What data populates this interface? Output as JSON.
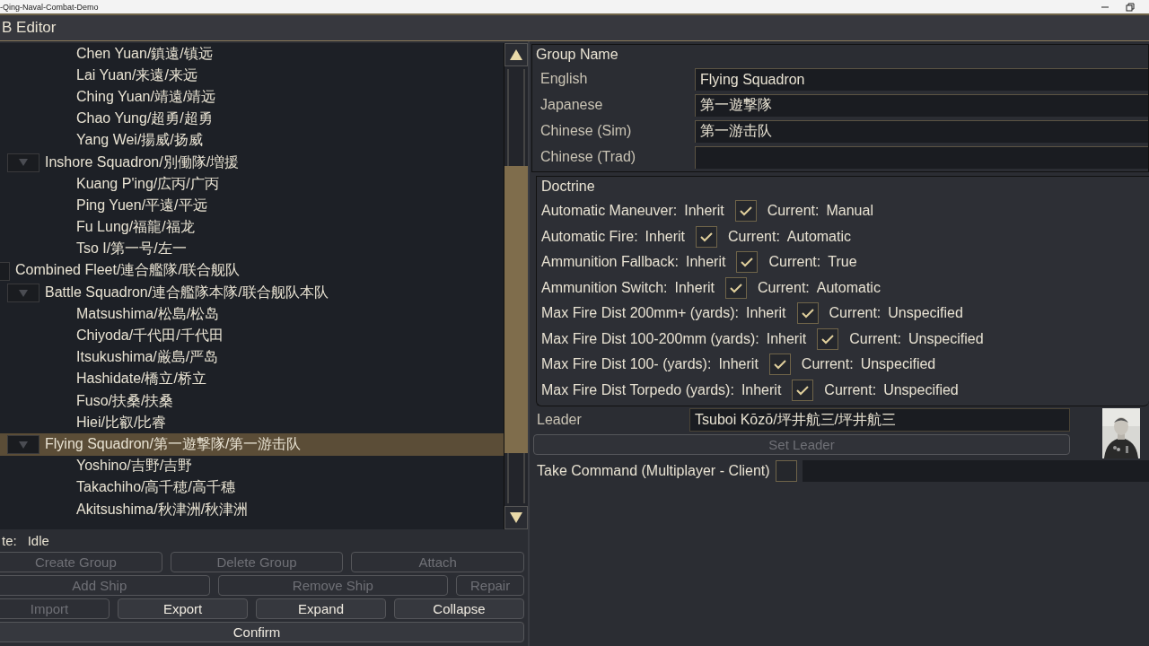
{
  "window": {
    "title": "-Qing-Naval-Combat-Demo"
  },
  "header": {
    "title": "B Editor"
  },
  "tree": [
    {
      "kind": "ship",
      "label": "Chen Yuan/鎮遠/镇远",
      "selected": false
    },
    {
      "kind": "ship",
      "label": "Lai Yuan/来遠/来远",
      "selected": false
    },
    {
      "kind": "ship",
      "label": "Ching Yuan/靖遠/靖远",
      "selected": false
    },
    {
      "kind": "ship",
      "label": "Chao Yung/超勇/超勇",
      "selected": false
    },
    {
      "kind": "ship",
      "label": "Yang Wei/揚威/扬威",
      "selected": false
    },
    {
      "kind": "squadron",
      "label": "Inshore Squadron/別働隊/増援",
      "selected": false,
      "expanded": true,
      "children": [
        {
          "kind": "ship",
          "label": "Kuang P'ing/広丙/广丙",
          "selected": false
        },
        {
          "kind": "ship",
          "label": "Ping Yuen/平遠/平远",
          "selected": false
        },
        {
          "kind": "ship",
          "label": "Fu Lung/福龍/福龙",
          "selected": false
        },
        {
          "kind": "ship",
          "label": "Tso I/第一号/左一",
          "selected": false
        }
      ]
    },
    {
      "kind": "fleet",
      "label": "Combined Fleet/連合艦隊/联合舰队",
      "selected": false,
      "expanded": true,
      "children": [
        {
          "kind": "squadron",
          "label": "Battle Squadron/連合艦隊本隊/联合舰队本队",
          "selected": false,
          "expanded": true,
          "children": [
            {
              "kind": "ship",
              "label": "Matsushima/松島/松岛",
              "selected": false
            },
            {
              "kind": "ship",
              "label": "Chiyoda/千代田/千代田",
              "selected": false
            },
            {
              "kind": "ship",
              "label": "Itsukushima/厳島/严岛",
              "selected": false
            },
            {
              "kind": "ship",
              "label": "Hashidate/橋立/桥立",
              "selected": false
            },
            {
              "kind": "ship",
              "label": "Fuso/扶桑/扶桑",
              "selected": false
            },
            {
              "kind": "ship",
              "label": "Hiei/比叡/比睿",
              "selected": false
            }
          ]
        },
        {
          "kind": "squadron",
          "label": "Flying Squadron/第一遊撃隊/第一游击队",
          "selected": true,
          "expanded": true,
          "children": [
            {
              "kind": "ship",
              "label": "Yoshino/吉野/吉野",
              "selected": false
            },
            {
              "kind": "ship",
              "label": "Takachiho/高千穂/高千穗",
              "selected": false
            },
            {
              "kind": "ship",
              "label": "Akitsushima/秋津洲/秋津洲",
              "selected": false
            }
          ]
        }
      ]
    }
  ],
  "status": {
    "label": "te:",
    "value": "Idle"
  },
  "button_rows": [
    [
      {
        "label": "Create Group",
        "disabled": true
      },
      {
        "label": "Delete Group",
        "disabled": true
      },
      {
        "label": "Attach",
        "disabled": true
      }
    ],
    [
      {
        "label": "Add Ship",
        "disabled": true
      },
      {
        "label": "Remove Ship",
        "disabled": true
      },
      {
        "label": "Repair",
        "disabled": true
      }
    ],
    [
      {
        "label": "Import",
        "disabled": true
      },
      {
        "label": "Export",
        "disabled": false
      },
      {
        "label": "Expand",
        "disabled": false
      },
      {
        "label": "Collapse",
        "disabled": false
      }
    ],
    [
      {
        "label": "Confirm",
        "disabled": false
      }
    ]
  ],
  "group_name": {
    "title": "Group Name",
    "fields": [
      {
        "label": "English",
        "value": "Flying Squadron"
      },
      {
        "label": "Japanese",
        "value": "第一遊撃隊"
      },
      {
        "label": "Chinese (Sim)",
        "value": "第一游击队"
      },
      {
        "label": "Chinese (Trad)"
      }
    ]
  },
  "doctrine": {
    "title": "Doctrine",
    "rows": [
      {
        "label": "Automatic Maneuver:",
        "inherit": "Inherit",
        "checked": true,
        "current_label": "Current:",
        "current": "Manual"
      },
      {
        "label": "Automatic Fire:",
        "inherit": "Inherit",
        "checked": true,
        "current_label": "Current:",
        "current": "Automatic"
      },
      {
        "label": "Ammunition Fallback:",
        "inherit": "Inherit",
        "checked": true,
        "current_label": "Current:",
        "current": "True"
      },
      {
        "label": "Ammunition Switch:",
        "inherit": "Inherit",
        "checked": true,
        "current_label": "Current:",
        "current": "Automatic"
      },
      {
        "label": "Max Fire Dist 200mm+ (yards):",
        "inherit": "Inherit",
        "checked": true,
        "current_label": "Current:",
        "current": "Unspecified"
      },
      {
        "label": "Max Fire Dist 100-200mm (yards):",
        "inherit": "Inherit",
        "checked": true,
        "current_label": "Current:",
        "current": "Unspecified"
      },
      {
        "label": "Max Fire Dist 100- (yards):",
        "inherit": "Inherit",
        "checked": true,
        "current_label": "Current:",
        "current": "Unspecified"
      },
      {
        "label": "Max Fire Dist Torpedo (yards):",
        "inherit": "Inherit",
        "checked": true,
        "current_label": "Current:",
        "current": "Unspecified"
      }
    ]
  },
  "leader": {
    "label": "Leader",
    "value": "Tsuboi Kōzō/坪井航三/坪井航三",
    "button": {
      "label": "Set Leader",
      "disabled": true
    }
  },
  "take_command": {
    "label": "Take Command (Multiplayer - Client)",
    "checked": false
  }
}
